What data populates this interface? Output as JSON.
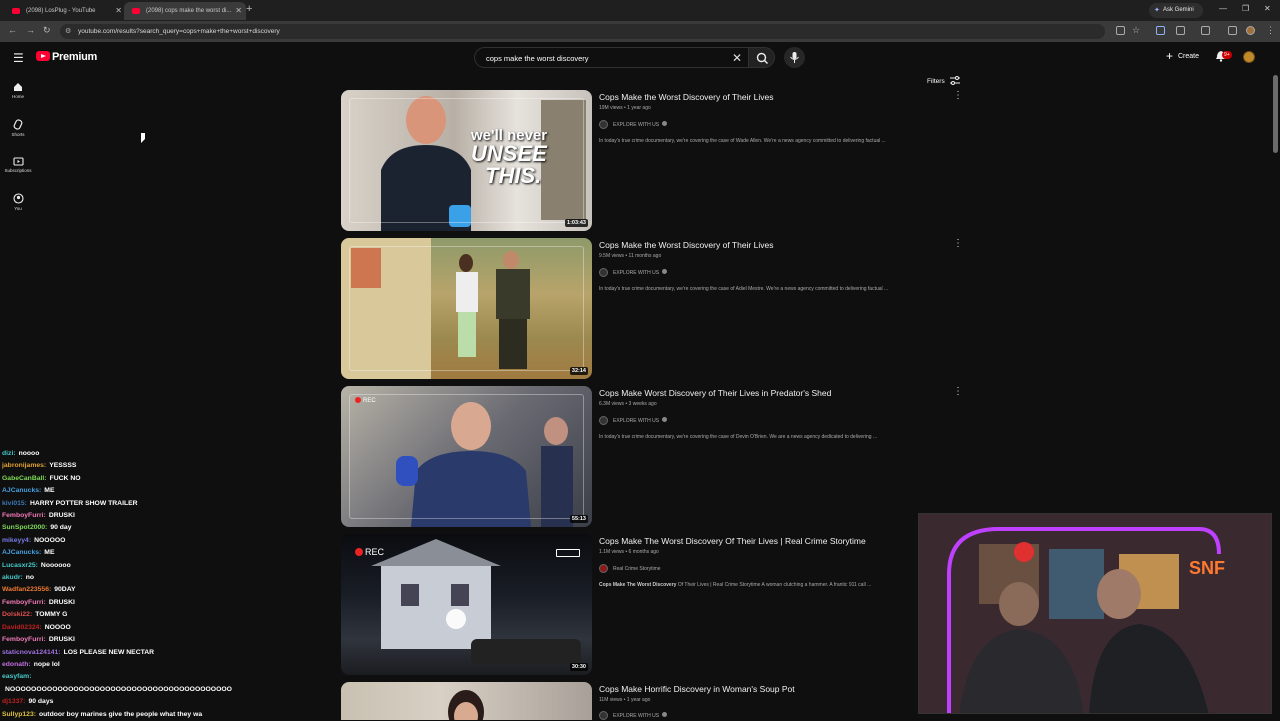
{
  "browser": {
    "tabs": [
      {
        "title": "(2098) LosPlug - YouTube"
      },
      {
        "title": "(2098) cops make the worst di..."
      }
    ],
    "ask_gemini": "Ask Gemini",
    "url": "youtube.com/results?search_query=cops+make+the+worst+discovery"
  },
  "header": {
    "brand": "Premium",
    "search_value": "cops make the worst discovery",
    "create_label": "Create",
    "notification_count": "9+"
  },
  "sidebar": {
    "items": [
      {
        "label": "Home",
        "icon": "home-icon"
      },
      {
        "label": "Shorts",
        "icon": "shorts-icon"
      },
      {
        "label": "Subscriptions",
        "icon": "subscriptions-icon"
      },
      {
        "label": "You",
        "icon": "you-icon"
      }
    ]
  },
  "filters_label": "Filters",
  "results": [
    {
      "title": "Cops Make the Worst Discovery of Their Lives",
      "meta": "19M views • 1 year ago",
      "channel": "EXPLORE WITH US",
      "description": "In today's true crime documentary, we're covering the case of Wade Allen. We're a news agency committed to delivering factual ...",
      "duration": "1:03:43",
      "thumb_text_1": "we'll never",
      "thumb_text_2": "UNSEE",
      "thumb_text_3": "THIS."
    },
    {
      "title": "Cops Make the Worst Discovery of Their Lives",
      "meta": "9.5M views • 11 months ago",
      "channel": "EXPLORE WITH US",
      "description": "In today's true crime documentary, we're covering the case of Adiel Mestre. We're a news agency committed to delivering factual ...",
      "duration": "32:14"
    },
    {
      "title": "Cops Make Worst Discovery of Their Lives in Predator's Shed",
      "meta": "6.3M views • 3 weeks ago",
      "channel": "EXPLORE WITH US",
      "description": "In today's true crime documentary, we're covering the case of Devin O'Brien. We are a news agency dedicated to delivering ...",
      "duration": "55:13",
      "rec": "REC"
    },
    {
      "title": "Cops Make The Worst Discovery Of Their Lives | Real Crime Storytime",
      "meta": "1.1M views • 6 months ago",
      "channel": "Real Crime Storytime",
      "description_bold": "Cops Make The Worst Discovery",
      "description": " Of Their Lives | Real Crime Storytime A woman clutching a hammer. A frantic 911 call ...",
      "duration": "30:30",
      "rec": "REC"
    },
    {
      "title": "Cops Make Horrific Discovery in Woman's Soup Pot",
      "meta": "11M views • 1 year ago",
      "channel": "EXPLORE WITH US"
    }
  ],
  "chat": [
    {
      "user": "dizi:",
      "msg": "noooo",
      "color": "#46c8c8"
    },
    {
      "user": "jabronijames:",
      "msg": "YESSSS",
      "color": "#e0a030"
    },
    {
      "user": "GabeCanBall:",
      "msg": "FUCK NO",
      "color": "#7ed957"
    },
    {
      "user": "AJCanucks:",
      "msg": "ME",
      "color": "#46a0e0"
    },
    {
      "user": "kivi015:",
      "msg": "HARRY POTTER SHOW TRAILER",
      "color": "#3a7ab8"
    },
    {
      "user": "FemboyFurri:",
      "msg": "DRUSKI",
      "color": "#f07ab8"
    },
    {
      "user": "SunSpot2000:",
      "msg": "90 day",
      "color": "#7ed957"
    },
    {
      "user": "mikeyy4:",
      "msg": "NOOOOO",
      "color": "#7a7ae8"
    },
    {
      "user": "AJCanucks:",
      "msg": "ME",
      "color": "#46a0e0"
    },
    {
      "user": "Lucasxr25:",
      "msg": "Noooooo",
      "color": "#46c8c8"
    },
    {
      "user": "akudr:",
      "msg": "no",
      "color": "#46c8c8"
    },
    {
      "user": "Wadfan223556:",
      "msg": "90DAY",
      "color": "#f07a30"
    },
    {
      "user": "FemboyFurri:",
      "msg": "DRUSKI",
      "color": "#f07ab8"
    },
    {
      "user": "Dolski22:",
      "msg": "TOMMY G",
      "color": "#e05050"
    },
    {
      "user": "David02324:",
      "msg": "NOOOO",
      "color": "#c02020"
    },
    {
      "user": "FemboyFurri:",
      "msg": "DRUSKI",
      "color": "#f07ab8"
    },
    {
      "user": "staticnova124141:",
      "msg": "LOS PLEASE NEW NECTAR",
      "color": "#a070e0"
    },
    {
      "user": "edonath:",
      "msg": "nope lol",
      "color": "#c070e0"
    },
    {
      "user": "easyfam:",
      "msg": "",
      "color": "#46c8c8"
    },
    {
      "user": "",
      "msg": "NOOOOOOOOOOOOOOOOOOOOOOOOOOOOOOOOOOOOOOOOOO",
      "color": "#ffffff"
    },
    {
      "user": "dj1337:",
      "msg": "90 days",
      "color": "#c02020"
    },
    {
      "user": "Sullyp123:",
      "msg": "outdoor boy marines give the people what they wa",
      "color": "#e0c040"
    }
  ]
}
